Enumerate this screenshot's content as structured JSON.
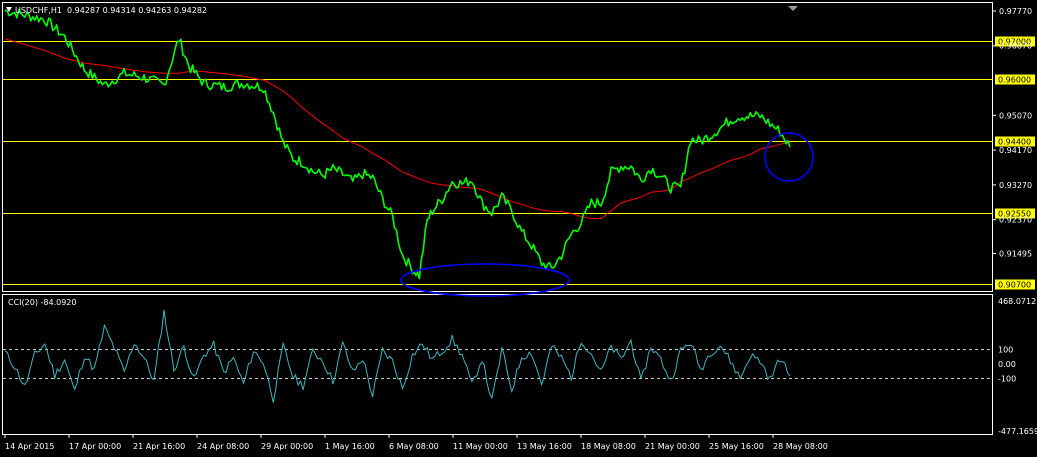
{
  "header": {
    "symbol": "USDCHF,H1",
    "ohlc": "0.94287 0.94314 0.94263 0.94282"
  },
  "cci_header": {
    "label": "CCI(20) -84.0920"
  },
  "colors": {
    "background": "#000000",
    "price": "#00ff00",
    "moving_average": "#ff0000",
    "level_line": "#ffff00",
    "level_tag_bg": "#ffff00",
    "cci": "#3fb6c0",
    "annotation": "#0000ff",
    "axis_text": "#ffffff"
  },
  "chart_data": [
    {
      "type": "line",
      "name": "price",
      "ylim": [
        0.9055,
        0.9795
      ],
      "y_ticks": [
        "0.97770",
        "0.96870",
        "0.95070",
        "0.94170",
        "0.93270",
        "0.92370",
        "0.91495"
      ],
      "levels": [
        "0.97000",
        "0.96000",
        "0.94400",
        "0.92550",
        "0.90700"
      ],
      "level_values": [
        0.97,
        0.96,
        0.944,
        0.9255,
        0.907
      ],
      "x_labels": [
        "14 Apr 2015",
        "17 Apr 00:00",
        "21 Apr 16:00",
        "24 Apr 08:00",
        "29 Apr 00:00",
        "1 May 16:00",
        "6 May 08:00",
        "11 May 00:00",
        "13 May 16:00",
        "18 May 08:00",
        "21 May 00:00",
        "25 May 16:00",
        "28 May 08:00"
      ],
      "x": [
        0,
        40,
        60,
        80,
        100,
        120,
        140,
        160,
        175,
        185,
        200,
        220,
        240,
        260,
        270,
        280,
        290,
        300,
        310,
        320,
        330,
        340,
        350,
        360,
        370,
        380,
        390,
        400,
        410,
        417,
        425,
        430,
        440,
        450,
        460,
        470,
        480,
        490,
        500,
        510,
        520,
        530,
        540,
        550,
        560,
        570,
        580,
        590,
        600,
        610,
        620,
        630,
        640,
        650,
        660,
        670,
        680,
        690,
        700,
        710,
        720,
        730,
        740,
        750,
        760,
        770,
        780,
        790
      ],
      "series": [
        {
          "name": "price",
          "values": [
            0.9778,
            0.9755,
            0.971,
            0.9625,
            0.9585,
            0.9615,
            0.9605,
            0.9585,
            0.9705,
            0.9635,
            0.959,
            0.958,
            0.959,
            0.958,
            0.9515,
            0.9435,
            0.9395,
            0.9385,
            0.9362,
            0.9352,
            0.9368,
            0.9355,
            0.9335,
            0.9355,
            0.9345,
            0.929,
            0.9245,
            0.9145,
            0.911,
            0.9092,
            0.9235,
            0.926,
            0.929,
            0.9335,
            0.933,
            0.934,
            0.928,
            0.9255,
            0.9295,
            0.926,
            0.9205,
            0.917,
            0.9125,
            0.911,
            0.9145,
            0.92,
            0.923,
            0.928,
            0.928,
            0.936,
            0.9375,
            0.9375,
            0.934,
            0.937,
            0.935,
            0.932,
            0.932,
            0.9445,
            0.944,
            0.9455,
            0.9475,
            0.9495,
            0.9505,
            0.9505,
            0.9505,
            0.9485,
            0.9465,
            0.9425
          ]
        },
        {
          "name": "moving_average",
          "values": [
            0.9705,
            0.9675,
            0.9655,
            0.9642,
            0.9636,
            0.9627,
            0.962,
            0.9616,
            0.9616,
            0.962,
            0.962,
            0.9615,
            0.9608,
            0.9598,
            0.9585,
            0.957,
            0.9549,
            0.9525,
            0.9505,
            0.9485,
            0.9468,
            0.9448,
            0.9436,
            0.9425,
            0.9408,
            0.9395,
            0.9378,
            0.936,
            0.935,
            0.9343,
            0.9335,
            0.9331,
            0.9327,
            0.9325,
            0.9321,
            0.9319,
            0.9315,
            0.9305,
            0.9295,
            0.9284,
            0.9277,
            0.9268,
            0.9262,
            0.9259,
            0.9258,
            0.9253,
            0.9245,
            0.924,
            0.924,
            0.926,
            0.928,
            0.9288,
            0.9295,
            0.9308,
            0.931,
            0.9315,
            0.9335,
            0.9345,
            0.9358,
            0.9367,
            0.9379,
            0.939,
            0.9397,
            0.9405,
            0.942,
            0.9425,
            0.9432,
            0.9438
          ]
        }
      ]
    },
    {
      "type": "line",
      "name": "CCI(20)",
      "ylim": [
        -477.1659,
        468.0712
      ],
      "y_ticks": [
        "468.0712",
        "100",
        "0.00",
        "-100",
        "-477.1659"
      ],
      "reference_lines": [
        100,
        -100
      ],
      "x": [
        0,
        10,
        20,
        30,
        40,
        50,
        60,
        70,
        80,
        90,
        100,
        110,
        120,
        130,
        140,
        150,
        160,
        170,
        180,
        190,
        200,
        210,
        220,
        230,
        240,
        250,
        260,
        270,
        280,
        290,
        300,
        310,
        320,
        330,
        340,
        350,
        360,
        370,
        380,
        390,
        400,
        410,
        420,
        430,
        440,
        450,
        460,
        470,
        480,
        490,
        500,
        510,
        520,
        530,
        540,
        550,
        560,
        570,
        580,
        590,
        600,
        610,
        620,
        630,
        640,
        650,
        660,
        670,
        680,
        690,
        700,
        710,
        720,
        730,
        740,
        750,
        760,
        770,
        780,
        790
      ],
      "series": [
        {
          "name": "CCI(20)",
          "values": [
            80,
            -20,
            -160,
            60,
            140,
            -80,
            30,
            -190,
            60,
            -40,
            250,
            110,
            -60,
            150,
            40,
            -120,
            360,
            -40,
            120,
            -110,
            60,
            130,
            -60,
            40,
            -140,
            90,
            10,
            -240,
            120,
            -90,
            -150,
            90,
            20,
            -120,
            140,
            -60,
            40,
            -220,
            90,
            20,
            -170,
            60,
            140,
            30,
            90,
            170,
            60,
            -150,
            40,
            -260,
            100,
            -180,
            50,
            80,
            -140,
            120,
            40,
            -90,
            170,
            70,
            -60,
            120,
            30,
            160,
            -130,
            120,
            30,
            -120,
            90,
            150,
            -40,
            80,
            130,
            20,
            -100,
            60,
            20,
            -110,
            40,
            -84
          ]
        }
      ]
    }
  ]
}
